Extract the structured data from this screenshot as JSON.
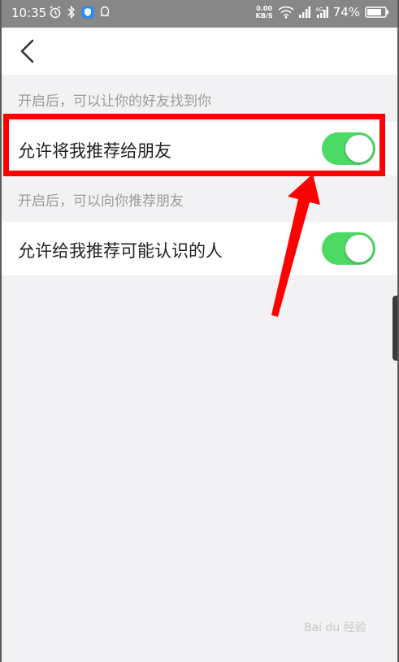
{
  "status_bar": {
    "time": "10:35",
    "net_speed": "0.00",
    "net_unit": "KB/S",
    "battery": "74%",
    "left_icons": [
      "alarm-icon",
      "bluetooth-icon",
      "shield-icon",
      "qq-icon"
    ],
    "right_icons": [
      "wifi-icon",
      "signal-icon",
      "signal-4g-icon",
      "battery-icon"
    ]
  },
  "nav": {
    "back_icon": "chevron-left-icon"
  },
  "sections": [
    {
      "hint": "开启后，可以让你的好友找到你",
      "label": "允许将我推荐给朋友",
      "enabled": true
    },
    {
      "hint": "开启后，可以向你推荐朋友",
      "label": "允许给我推荐可能认识的人",
      "enabled": true
    }
  ],
  "colors": {
    "toggle_on": "#4cd964",
    "highlight": "#ff0000",
    "statusbar": "#878787"
  },
  "watermark": "Bai du 经验"
}
